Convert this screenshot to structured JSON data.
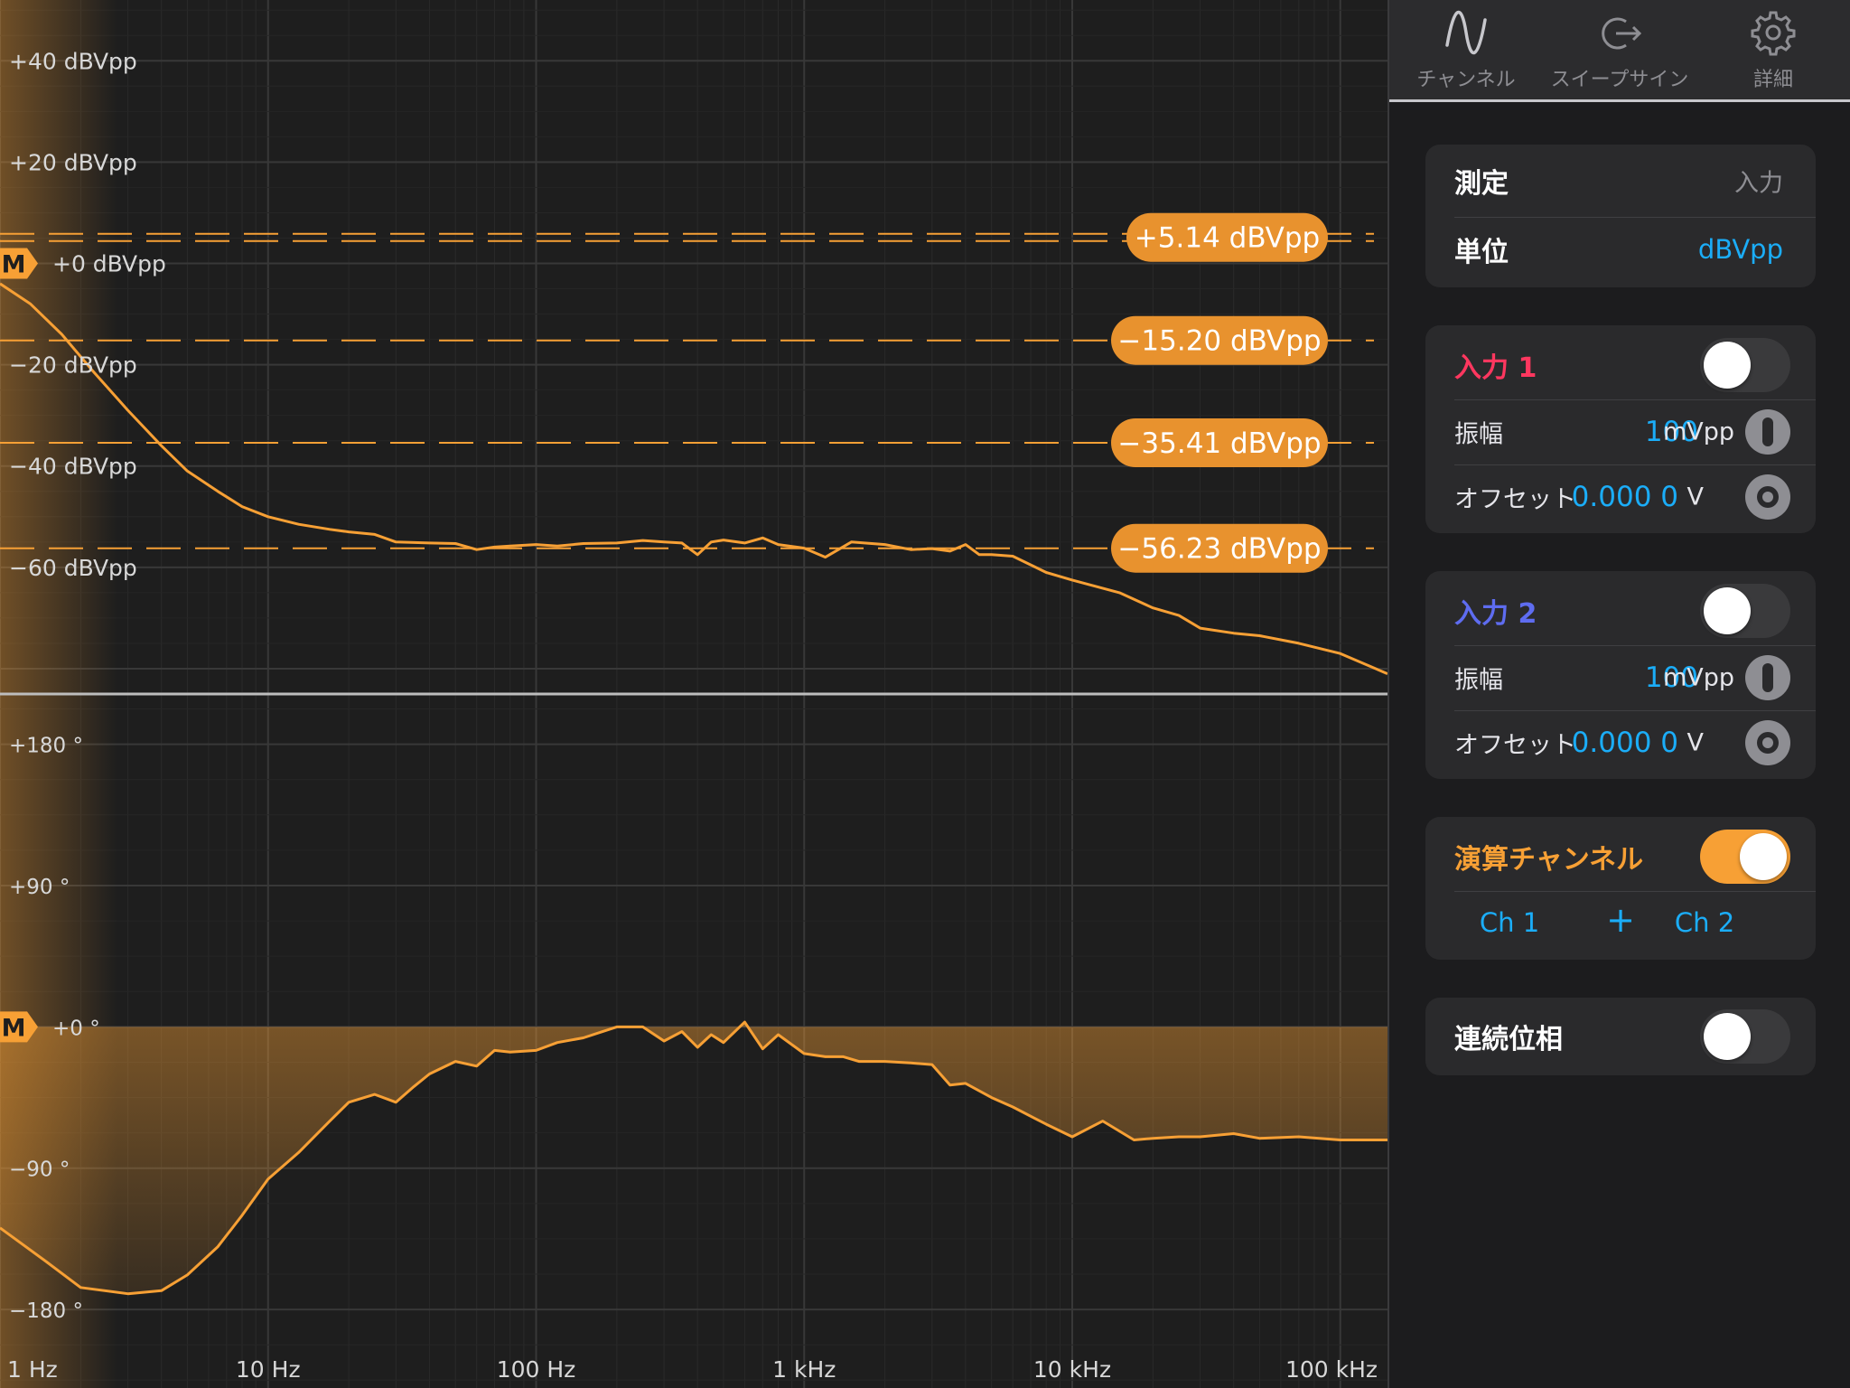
{
  "tabs": [
    {
      "label": "チャンネル",
      "icon": "sine-wave-icon"
    },
    {
      "label": "スイープサイン",
      "icon": "sweep-export-icon"
    },
    {
      "label": "詳細",
      "icon": "gear-icon"
    }
  ],
  "measurement": {
    "label": "測定",
    "value": "入力"
  },
  "unit": {
    "label": "単位",
    "value": "dBVpp"
  },
  "input1": {
    "title": "入力 1",
    "color": "#ff375f",
    "enabled": false,
    "amplitude_label": "振幅",
    "amplitude_value": "100",
    "amplitude_unit": "mVpp",
    "offset_label": "オフセット",
    "offset_value": "0.000 0",
    "offset_unit": "V"
  },
  "input2": {
    "title": "入力 2",
    "color": "#5e6cf0",
    "enabled": false,
    "amplitude_label": "振幅",
    "amplitude_value": "100",
    "amplitude_unit": "mVpp",
    "offset_label": "オフセット",
    "offset_value": "0.000 0",
    "offset_unit": "V"
  },
  "math_channel": {
    "title": "演算チャンネル",
    "color": "#f7a035",
    "enabled": true,
    "ch_a": "Ch 1",
    "op": "+",
    "ch_b": "Ch 2"
  },
  "continuous_phase": {
    "label": "連続位相",
    "enabled": false
  },
  "colors": {
    "trace": "#f7a035",
    "accent_blue": "#1badf8",
    "grid_bg": "#1e1e1e"
  },
  "chart_data": [
    {
      "type": "line",
      "title": "",
      "x_scale": "log",
      "xlim": [
        1,
        150000
      ],
      "ylim": [
        -85,
        52
      ],
      "x_ticks": [
        {
          "value": 1,
          "label": "1 Hz"
        },
        {
          "value": 10,
          "label": "10 Hz"
        },
        {
          "value": 100,
          "label": "100 Hz"
        },
        {
          "value": 1000,
          "label": "1 kHz"
        },
        {
          "value": 10000,
          "label": "10 kHz"
        },
        {
          "value": 100000,
          "label": "100 kHz"
        }
      ],
      "y_ticks": [
        {
          "value": 40,
          "label": "+40 dBVpp"
        },
        {
          "value": 20,
          "label": "+20 dBVpp"
        },
        {
          "value": 0,
          "label": "+0 dBVpp"
        },
        {
          "value": -20,
          "label": "−20 dBVpp"
        },
        {
          "value": -40,
          "label": "−40 dBVpp"
        },
        {
          "value": -60,
          "label": "−60 dBVpp"
        }
      ],
      "marker": {
        "label": "M",
        "value": 0
      },
      "cursors": [
        {
          "value": 5.14,
          "label": "+5.14 dBVpp",
          "style": "double-dashed"
        },
        {
          "value": -15.2,
          "label": "−15.20 dBVpp",
          "style": "dashed"
        },
        {
          "value": -35.41,
          "label": "−35.41 dBVpp",
          "style": "dashed"
        },
        {
          "value": -56.23,
          "label": "−56.23 dBVpp",
          "style": "dashed"
        }
      ],
      "series": [
        {
          "x": [
            1,
            1.3,
            1.7,
            2.2,
            3,
            4,
            5,
            6.5,
            8,
            10,
            13,
            17,
            20,
            25,
            30,
            40,
            50,
            60,
            70,
            80,
            100,
            120,
            150,
            200,
            250,
            300,
            350,
            400,
            450,
            500,
            600,
            700,
            800,
            1000,
            1200,
            1500,
            2000,
            2500,
            3000,
            3500,
            4000,
            4500,
            5000,
            6000,
            8000,
            10000,
            15000,
            20000,
            25000,
            30000,
            40000,
            50000,
            70000,
            100000,
            150000
          ],
          "y": [
            -4,
            -8,
            -14,
            -21,
            -29,
            -36,
            -41,
            -45,
            -48,
            -50,
            -51.5,
            -52.5,
            -53,
            -53.5,
            -55,
            -55.2,
            -55.3,
            -56.5,
            -56,
            -55.8,
            -55.5,
            -55.8,
            -55.3,
            -55.2,
            -54.7,
            -55,
            -55.2,
            -57.5,
            -55,
            -54.6,
            -55.2,
            -54.2,
            -55.5,
            -56.2,
            -58,
            -55,
            -55.5,
            -56.5,
            -56.3,
            -56.8,
            -55.5,
            -57.5,
            -57.5,
            -57.8,
            -61,
            -62.5,
            -65,
            -68,
            -69.5,
            -72,
            -73,
            -73.5,
            -75,
            -77,
            -81
          ]
        }
      ]
    },
    {
      "type": "area",
      "title": "",
      "x_scale": "log",
      "xlim": [
        1,
        150000
      ],
      "ylim": [
        -230,
        212
      ],
      "x_ticks": [
        {
          "value": 1,
          "label": "1 Hz"
        },
        {
          "value": 10,
          "label": "10 Hz"
        },
        {
          "value": 100,
          "label": "100 Hz"
        },
        {
          "value": 1000,
          "label": "1 kHz"
        },
        {
          "value": 10000,
          "label": "10 kHz"
        },
        {
          "value": 100000,
          "label": "100 kHz"
        }
      ],
      "y_ticks": [
        {
          "value": 180,
          "label": "+180 °"
        },
        {
          "value": 90,
          "label": "+90 °"
        },
        {
          "value": 0,
          "label": "+0 °"
        },
        {
          "value": -90,
          "label": "−90 °"
        },
        {
          "value": -180,
          "label": "−180 °"
        }
      ],
      "marker": {
        "label": "M",
        "value": 0
      },
      "series": [
        {
          "x": [
            1,
            1.5,
            2,
            3,
            4,
            5,
            6.5,
            8,
            10,
            13,
            17,
            20,
            25,
            30,
            35,
            40,
            50,
            60,
            70,
            80,
            100,
            120,
            150,
            200,
            250,
            300,
            350,
            400,
            450,
            500,
            600,
            700,
            800,
            1000,
            1200,
            1400,
            1600,
            2000,
            2500,
            3000,
            3500,
            4000,
            5000,
            6000,
            8000,
            10000,
            13000,
            17000,
            20000,
            25000,
            30000,
            40000,
            50000,
            70000,
            100000,
            150000
          ],
          "y": [
            -128,
            -150,
            -166,
            -170,
            -168,
            -158,
            -140,
            -120,
            -97,
            -80,
            -60,
            -48,
            -43,
            -48,
            -38,
            -30,
            -22,
            -25,
            -15,
            -16,
            -15,
            -10,
            -7,
            0,
            0,
            -9,
            -3,
            -13,
            -5,
            -10,
            3,
            -14,
            -5,
            -17,
            -19,
            -19,
            -22,
            -22,
            -23,
            -24,
            -37,
            -36,
            -45,
            -51,
            -62,
            -70,
            -60,
            -72,
            -71,
            -70,
            -70,
            -68,
            -71,
            -70,
            -72,
            -72
          ]
        }
      ]
    }
  ]
}
